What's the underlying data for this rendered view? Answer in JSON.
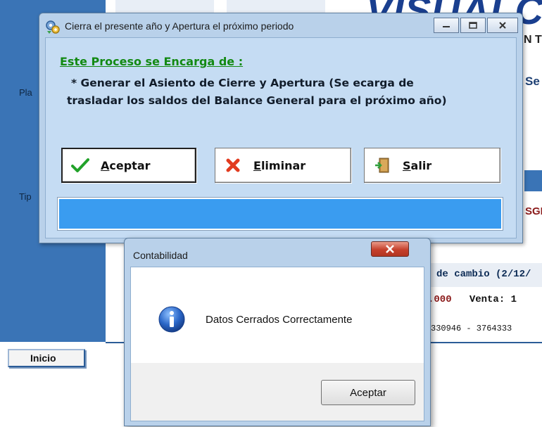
{
  "background": {
    "left_labels": [
      "Pla",
      "Tip"
    ],
    "logo_text": "VISUALC",
    "right_texts": {
      "line1": "N T",
      "line2": "Se",
      "line3": "SGE"
    },
    "exchange": {
      "header": "de cambio (2/12/",
      "values_prefix": ".000",
      "values_label": "Venta: 1",
      "phones": "330946 - 3764333"
    },
    "start_tab": "Inicio",
    "colors": {
      "panel_blue": "#3a74b6",
      "logo_blue": "#1a3f8f"
    }
  },
  "main_dialog": {
    "title": "Cierra el presente año y Apertura el próximo periodo",
    "title_icon": "gears-app-icon",
    "caption_buttons": [
      "minimize",
      "maximize",
      "close"
    ],
    "heading": "Este Proceso se Encarga de :",
    "description_line1": "* Generar el Asiento de Cierre y Apertura (Se ecarga de",
    "description_line2": "trasladar los saldos del Balance General para el próximo año)",
    "buttons": {
      "accept": {
        "hotkey": "A",
        "rest": "ceptar",
        "icon": "checkmark-icon"
      },
      "delete": {
        "hotkey": "E",
        "rest": "liminar",
        "icon": "red-x-icon"
      },
      "exit": {
        "hotkey": "S",
        "rest": "alir",
        "icon": "exit-door-icon"
      }
    },
    "progress": {
      "percent": 100,
      "fill_color": "#3a9cf0"
    }
  },
  "message_box": {
    "title": "Contabilidad",
    "icon": "info-icon",
    "message": "Datos Cerrados Correctamente",
    "ok_label": "Aceptar"
  }
}
